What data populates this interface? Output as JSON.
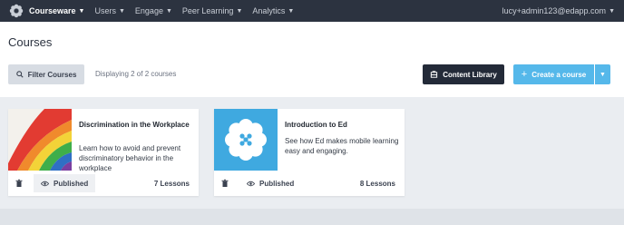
{
  "topbar": {
    "nav": [
      {
        "label": "Courseware",
        "active": true
      },
      {
        "label": "Users",
        "active": false
      },
      {
        "label": "Engage",
        "active": false
      },
      {
        "label": "Peer Learning",
        "active": false
      },
      {
        "label": "Analytics",
        "active": false
      }
    ],
    "user_email": "lucy+admin123@edapp.com"
  },
  "header": {
    "title": "Courses",
    "filter_label": "Filter Courses",
    "count_text": "Displaying 2 of 2 courses",
    "library_label": "Content Library",
    "create_label": "Create a course"
  },
  "courses": [
    {
      "title": "Discrimination in the Workplace",
      "description": "Learn how to avoid and prevent discriminatory behavior in the workplace",
      "status": "Published",
      "lessons": "7 Lessons",
      "thumb": "rainbow-flag-image"
    },
    {
      "title": "Introduction to Ed",
      "description": "See how Ed makes mobile learning easy and engaging.",
      "status": "Published",
      "lessons": "8 Lessons",
      "thumb": "ed-flower-logo"
    }
  ],
  "colors": {
    "topbar": "#2c3340",
    "accent": "#55b8ea",
    "dark_button": "#232a38",
    "background": "#eaedf1"
  }
}
